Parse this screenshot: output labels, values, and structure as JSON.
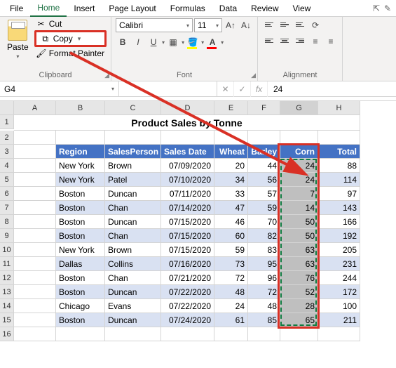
{
  "tabs": [
    "File",
    "Home",
    "Insert",
    "Page Layout",
    "Formulas",
    "Data",
    "Review",
    "View"
  ],
  "active_tab": "Home",
  "clipboard": {
    "cut": "Cut",
    "copy": "Copy",
    "format_painter": "Format Painter",
    "paste": "Paste",
    "group": "Clipboard"
  },
  "font": {
    "name": "Calibri",
    "size": "11",
    "group": "Font"
  },
  "alignment": {
    "group": "Alignment"
  },
  "name_box": "G4",
  "formula_value": "24",
  "fx_label": "fx",
  "columns": [
    "A",
    "B",
    "C",
    "D",
    "E",
    "F",
    "G",
    "H"
  ],
  "rows": [
    "1",
    "2",
    "3",
    "4",
    "5",
    "6",
    "7",
    "8",
    "9",
    "10",
    "11",
    "12",
    "13",
    "14",
    "15",
    "16"
  ],
  "title": "Product Sales by Tonne",
  "headers": [
    "Region",
    "SalesPerson",
    "Sales Date",
    "Wheat",
    "Barley",
    "Corn",
    "Total"
  ],
  "data": [
    [
      "New York",
      "Brown",
      "07/09/2020",
      "20",
      "44",
      "24",
      "88"
    ],
    [
      "New York",
      "Patel",
      "07/10/2020",
      "34",
      "56",
      "24",
      "114"
    ],
    [
      "Boston",
      "Duncan",
      "07/11/2020",
      "33",
      "57",
      "7",
      "97"
    ],
    [
      "Boston",
      "Chan",
      "07/14/2020",
      "47",
      "59",
      "14",
      "143"
    ],
    [
      "Boston",
      "Duncan",
      "07/15/2020",
      "46",
      "70",
      "50",
      "166"
    ],
    [
      "Boston",
      "Chan",
      "07/15/2020",
      "60",
      "82",
      "50",
      "192"
    ],
    [
      "New York",
      "Brown",
      "07/15/2020",
      "59",
      "83",
      "63",
      "205"
    ],
    [
      "Dallas",
      "Collins",
      "07/16/2020",
      "73",
      "95",
      "63",
      "231"
    ],
    [
      "Boston",
      "Chan",
      "07/21/2020",
      "72",
      "96",
      "76",
      "244"
    ],
    [
      "Boston",
      "Duncan",
      "07/22/2020",
      "48",
      "72",
      "52",
      "172"
    ],
    [
      "Chicago",
      "Evans",
      "07/22/2020",
      "24",
      "48",
      "28",
      "100"
    ],
    [
      "Boston",
      "Duncan",
      "07/24/2020",
      "61",
      "85",
      "65",
      "211"
    ]
  ],
  "chart_data": {
    "type": "table",
    "title": "Product Sales by Tonne",
    "columns": [
      "Region",
      "SalesPerson",
      "Sales Date",
      "Wheat",
      "Barley",
      "Corn",
      "Total"
    ],
    "rows": [
      {
        "Region": "New York",
        "SalesPerson": "Brown",
        "Sales Date": "07/09/2020",
        "Wheat": 20,
        "Barley": 44,
        "Corn": 24,
        "Total": 88
      },
      {
        "Region": "New York",
        "SalesPerson": "Patel",
        "Sales Date": "07/10/2020",
        "Wheat": 34,
        "Barley": 56,
        "Corn": 24,
        "Total": 114
      },
      {
        "Region": "Boston",
        "SalesPerson": "Duncan",
        "Sales Date": "07/11/2020",
        "Wheat": 33,
        "Barley": 57,
        "Corn": 7,
        "Total": 97
      },
      {
        "Region": "Boston",
        "SalesPerson": "Chan",
        "Sales Date": "07/14/2020",
        "Wheat": 47,
        "Barley": 59,
        "Corn": 14,
        "Total": 143
      },
      {
        "Region": "Boston",
        "SalesPerson": "Duncan",
        "Sales Date": "07/15/2020",
        "Wheat": 46,
        "Barley": 70,
        "Corn": 50,
        "Total": 166
      },
      {
        "Region": "Boston",
        "SalesPerson": "Chan",
        "Sales Date": "07/15/2020",
        "Wheat": 60,
        "Barley": 82,
        "Corn": 50,
        "Total": 192
      },
      {
        "Region": "New York",
        "SalesPerson": "Brown",
        "Sales Date": "07/15/2020",
        "Wheat": 59,
        "Barley": 83,
        "Corn": 63,
        "Total": 205
      },
      {
        "Region": "Dallas",
        "SalesPerson": "Collins",
        "Sales Date": "07/16/2020",
        "Wheat": 73,
        "Barley": 95,
        "Corn": 63,
        "Total": 231
      },
      {
        "Region": "Boston",
        "SalesPerson": "Chan",
        "Sales Date": "07/21/2020",
        "Wheat": 72,
        "Barley": 96,
        "Corn": 76,
        "Total": 244
      },
      {
        "Region": "Boston",
        "SalesPerson": "Duncan",
        "Sales Date": "07/22/2020",
        "Wheat": 48,
        "Barley": 72,
        "Corn": 52,
        "Total": 172
      },
      {
        "Region": "Chicago",
        "SalesPerson": "Evans",
        "Sales Date": "07/22/2020",
        "Wheat": 24,
        "Barley": 48,
        "Corn": 28,
        "Total": 100
      },
      {
        "Region": "Boston",
        "SalesPerson": "Duncan",
        "Sales Date": "07/24/2020",
        "Wheat": 61,
        "Barley": 85,
        "Corn": 65,
        "Total": 211
      }
    ]
  }
}
